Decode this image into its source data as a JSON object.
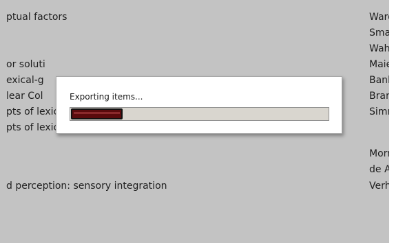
{
  "list": {
    "rows": [
      {
        "title": "ptual factors",
        "author": "Ward"
      },
      {
        "title": "",
        "author": "Smal"
      },
      {
        "title": "",
        "author": "Wahl"
      },
      {
        "title": "or soluti",
        "author": "Maie"
      },
      {
        "title": "exical-g",
        "author": "Bank"
      },
      {
        "title": "lear Col",
        "author": "Brang"
      },
      {
        "title": "pts of lexical-gustatory synaesthesia",
        "author": "Simn"
      },
      {
        "title": "pts of lexical-gustatory synaesthesia - ScienceDirect",
        "author": ""
      },
      {
        "title": "",
        "author": "Morr"
      },
      {
        "title": "",
        "author": "de A"
      },
      {
        "title": "d perception: sensory integration",
        "author": "Verh"
      }
    ]
  },
  "dialog": {
    "message": "Exporting items...",
    "progress": 0.2
  }
}
